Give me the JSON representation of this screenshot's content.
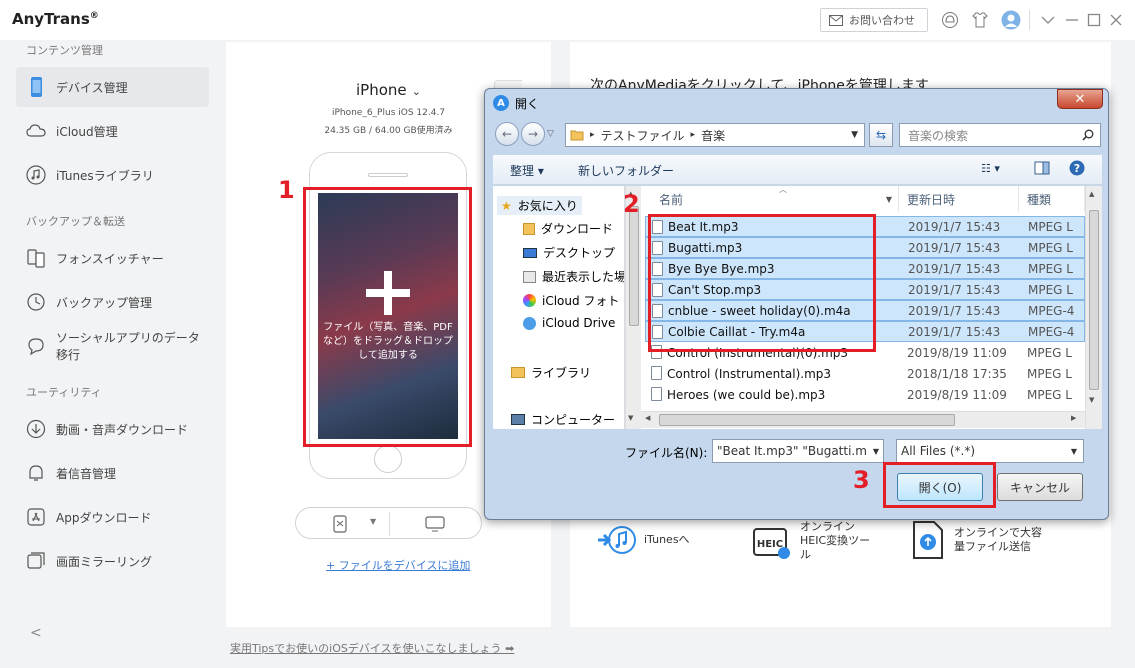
{
  "app": {
    "title": "AnyTrans",
    "registered": "®",
    "contact": "お問い合わせ"
  },
  "sidebar": {
    "sections": [
      "コンテンツ管理",
      "バックアップ＆転送",
      "ユーティリティ"
    ],
    "items": [
      {
        "label": "デバイス管理",
        "icon": "phone-icon",
        "active": true
      },
      {
        "label": "iCloud管理",
        "icon": "cloud-icon"
      },
      {
        "label": "iTunesライブラリ",
        "icon": "music-note-icon"
      },
      {
        "label": "フォンスイッチャー",
        "icon": "switch-icon"
      },
      {
        "label": "バックアップ管理",
        "icon": "history-icon"
      },
      {
        "label": "ソーシャルアプリのデータ移行",
        "icon": "chat-icon"
      },
      {
        "label": "動画・音声ダウンロード",
        "icon": "download-icon"
      },
      {
        "label": "着信音管理",
        "icon": "bell-icon"
      },
      {
        "label": "Appダウンロード",
        "icon": "appstore-icon"
      },
      {
        "label": "画面ミラーリング",
        "icon": "mirror-icon"
      }
    ],
    "collapse": "<"
  },
  "device": {
    "name": "iPhone",
    "model": "iPhone_6_Plus iOS 12.4.7",
    "storage": "24.35 GB / 64.00 GB使用済み",
    "drop_hint": "ファイル（写真、音楽、PDFなど）をドラッグ＆ドロップして追加する",
    "add_link": "+ ファイルをデバイスに追加"
  },
  "right_panel": {
    "heading": "次のAnyMediaをクリックして、iPhoneを管理します",
    "actions": [
      {
        "label": "iTunesへ",
        "icon": "itunes-transfer-icon"
      },
      {
        "label": "オンラインHEIC変換ツール",
        "icon": "heic-icon"
      },
      {
        "label": "オンラインで大容量ファイル送信",
        "icon": "upload-file-icon"
      }
    ]
  },
  "footer": {
    "tip": "実用Tipsでお使いのiOSデバイスを使いこなしましょう ➡"
  },
  "steps": {
    "one": "1",
    "two": "2",
    "three": "3"
  },
  "dialog": {
    "title": "開く",
    "path": [
      "テストファイル",
      "音楽"
    ],
    "search_placeholder": "音楽の検索",
    "organize": "整理 ▾",
    "new_folder": "新しいフォルダー",
    "nav": [
      {
        "label": "お気に入り",
        "icon": "star-icon"
      },
      {
        "label": "ダウンロード",
        "icon": "download-folder-icon"
      },
      {
        "label": "デスクトップ",
        "icon": "desktop-icon"
      },
      {
        "label": "最近表示した場",
        "icon": "recent-icon"
      },
      {
        "label": "iCloud フォト",
        "icon": "icloud-photo-icon"
      },
      {
        "label": "iCloud Drive",
        "icon": "icloud-drive-icon"
      },
      {
        "label": "ライブラリ",
        "icon": "library-icon"
      },
      {
        "label": "コンピューター",
        "icon": "computer-icon"
      }
    ],
    "columns": [
      "名前",
      "更新日時",
      "種類"
    ],
    "files": [
      {
        "name": "Beat It.mp3",
        "date": "2019/1/7 15:43",
        "type": "MPEG L",
        "selected": true
      },
      {
        "name": "Bugatti.mp3",
        "date": "2019/1/7 15:43",
        "type": "MPEG L",
        "selected": true
      },
      {
        "name": "Bye Bye Bye.mp3",
        "date": "2019/1/7 15:43",
        "type": "MPEG L",
        "selected": true
      },
      {
        "name": "Can't Stop.mp3",
        "date": "2019/1/7 15:43",
        "type": "MPEG L",
        "selected": true
      },
      {
        "name": "cnblue - sweet holiday(0).m4a",
        "date": "2019/1/7 15:43",
        "type": "MPEG-4",
        "selected": true
      },
      {
        "name": "Colbie Caillat - Try.m4a",
        "date": "2019/1/7 15:43",
        "type": "MPEG-4",
        "selected": true
      },
      {
        "name": "Control (Instrumental)(0).mp3",
        "date": "2019/8/19 11:09",
        "type": "MPEG L",
        "selected": false
      },
      {
        "name": "Control (Instrumental).mp3",
        "date": "2018/1/18 17:35",
        "type": "MPEG L",
        "selected": false
      },
      {
        "name": "Heroes (we could be).mp3",
        "date": "2019/8/19 11:09",
        "type": "MPEG L",
        "selected": false
      }
    ],
    "filename_label": "ファイル名(N):",
    "filename_value": "\"Beat It.mp3\" \"Bugatti.m",
    "filetype_value": "All Files (*.*)",
    "open_button": "開く(O)",
    "cancel_button": "キャンセル"
  }
}
